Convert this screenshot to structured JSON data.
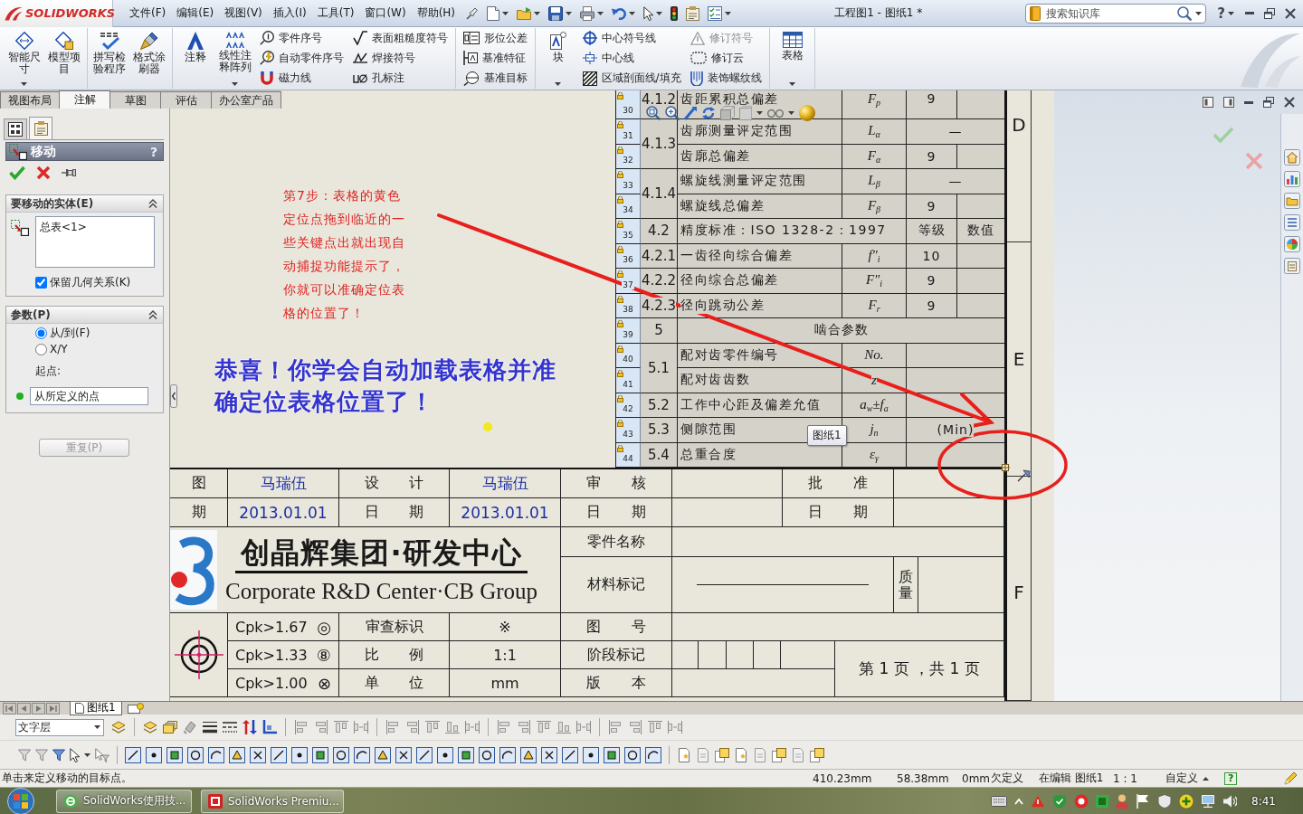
{
  "window": {
    "logo": "SOLIDWORKS",
    "menu": [
      "文件(F)",
      "编辑(E)",
      "视图(V)",
      "插入(I)",
      "工具(T)",
      "窗口(W)",
      "帮助(H)"
    ],
    "title": "工程图1 - 图纸1 *",
    "search": {
      "placeholder": "搜索知识库"
    },
    "help": "?"
  },
  "ribbon": {
    "groups": [
      {
        "items": [
          {
            "kind": "large",
            "label": "智能尺寸",
            "dropdown": true,
            "disabled": false
          },
          {
            "kind": "large",
            "label": "模型项目",
            "dropdown": false,
            "disabled": false
          }
        ]
      },
      {
        "items": [
          {
            "kind": "large",
            "label": "拼写检验程序",
            "dropdown": false,
            "disabled": false
          },
          {
            "kind": "large",
            "label": "格式涂刷器",
            "dropdown": false,
            "disabled": false
          }
        ]
      },
      {
        "items": [
          {
            "kind": "large",
            "label": "注释",
            "dropdown": false,
            "disabled": false
          },
          {
            "kind": "large",
            "label": "线性注释阵列",
            "dropdown": true,
            "disabled": false
          },
          {
            "kind": "small",
            "label": "零件序号",
            "dropdown": false,
            "disabled": false
          },
          {
            "kind": "small",
            "label": "自动零件序号",
            "dropdown": false,
            "disabled": false
          },
          {
            "kind": "small",
            "label": "磁力线",
            "dropdown": false,
            "disabled": false
          },
          {
            "kind": "small",
            "label": "表面粗糙度符号",
            "dropdown": false,
            "disabled": false
          },
          {
            "kind": "small",
            "label": "焊接符号",
            "dropdown": false,
            "disabled": false
          },
          {
            "kind": "small",
            "label": "孔标注",
            "dropdown": false,
            "disabled": false
          }
        ]
      },
      {
        "items": [
          {
            "kind": "small",
            "label": "形位公差",
            "dropdown": false,
            "disabled": false
          },
          {
            "kind": "small",
            "label": "基准特征",
            "dropdown": false,
            "disabled": false
          },
          {
            "kind": "small",
            "label": "基准目标",
            "dropdown": false,
            "disabled": false
          }
        ]
      },
      {
        "items": [
          {
            "kind": "large",
            "label": "块",
            "dropdown": true,
            "disabled": false
          },
          {
            "kind": "small",
            "label": "中心符号线",
            "dropdown": false,
            "disabled": false
          },
          {
            "kind": "small",
            "label": "中心线",
            "dropdown": false,
            "disabled": false
          },
          {
            "kind": "small",
            "label": "区域剖面线/填充",
            "dropdown": false,
            "disabled": false
          },
          {
            "kind": "small",
            "label": "修订符号",
            "dropdown": false,
            "disabled": true
          },
          {
            "kind": "small",
            "label": "修订云",
            "dropdown": false,
            "disabled": false
          },
          {
            "kind": "small",
            "label": "装饰螺纹线",
            "dropdown": false,
            "disabled": false
          }
        ]
      },
      {
        "items": [
          {
            "kind": "large",
            "label": "表格",
            "dropdown": true,
            "disabled": false
          }
        ]
      }
    ],
    "tabs": [
      {
        "label": "视图布局",
        "selected": false
      },
      {
        "label": "注解",
        "selected": true
      },
      {
        "label": "草图",
        "selected": false
      },
      {
        "label": "评估",
        "selected": false
      },
      {
        "label": "办公室产品",
        "selected": false
      }
    ]
  },
  "property_manager": {
    "tabs": [
      {
        "selected": false
      },
      {
        "selected": true
      }
    ],
    "title": "移动",
    "help": "?",
    "entities": {
      "title": "要移动的实体(E)",
      "expanded": true,
      "items": [
        "总表<1>"
      ],
      "checkbox": {
        "label": "保留几何关系(K)",
        "checked": true
      }
    },
    "parameters": {
      "title": "参数(P)",
      "expanded": true,
      "options": [
        {
          "label": "从/到(F)",
          "selected": true
        },
        {
          "label": "X/Y",
          "selected": false
        }
      ],
      "start_label": "起点:",
      "start_point": {
        "value": "从所定义的点"
      }
    },
    "repeat_button": {
      "label": "重复(P)",
      "disabled": true
    }
  },
  "drawing": {
    "note": "第7步：表格的黄色定位点拖到临近的一些关键点出就出现自动捕捉功能提示了，你就可以准确定位表格的位置了！",
    "headline": "恭喜！你学会自动加载表格并准确定位表格位置了！",
    "table": {
      "rows": [
        {
          "number": "30",
          "cells": [
            {
              "kind": "index",
              "text": "4.1.2"
            },
            {
              "kind": "text",
              "text": "齿距累积总偏差"
            },
            {
              "kind": "symbol",
              "text": "F$_{p}$"
            },
            {
              "kind": "value",
              "text": "9"
            },
            {
              "kind": "blank"
            }
          ]
        },
        {
          "number": "31",
          "cells": [
            {
              "kind": "index",
              "text": "4.1.3",
              "rowspan": 2
            },
            {
              "kind": "text",
              "text": "齿廓测量评定范围"
            },
            {
              "kind": "symbol",
              "text": "L$_{α}$"
            },
            {
              "kind": "value",
              "text": "—",
              "colspan": 2
            }
          ]
        },
        {
          "number": "32",
          "cells": [
            {
              "kind": "text",
              "text": "齿廓总偏差"
            },
            {
              "kind": "symbol",
              "text": "F$_{α}$"
            },
            {
              "kind": "value",
              "text": "9"
            },
            {
              "kind": "blank"
            }
          ]
        },
        {
          "number": "33",
          "cells": [
            {
              "kind": "index",
              "text": "4.1.4",
              "rowspan": 2
            },
            {
              "kind": "text",
              "text": "螺旋线测量评定范围"
            },
            {
              "kind": "symbol",
              "text": "L$_{β}$"
            },
            {
              "kind": "value",
              "text": "—",
              "colspan": 2
            }
          ]
        },
        {
          "number": "34",
          "cells": [
            {
              "kind": "text",
              "text": "螺旋线总偏差"
            },
            {
              "kind": "symbol",
              "text": "F$_{β}$"
            },
            {
              "kind": "value",
              "text": "9"
            },
            {
              "kind": "blank"
            }
          ]
        },
        {
          "number": "35",
          "cells": [
            {
              "kind": "index",
              "text": "4.2"
            },
            {
              "kind": "text",
              "text": "精度标准：ISO 1328-2：1997",
              "colspan": 2
            },
            {
              "kind": "value",
              "text": "等级"
            },
            {
              "kind": "value",
              "text": "数值"
            }
          ]
        },
        {
          "number": "36",
          "cells": [
            {
              "kind": "index",
              "text": "4.2.1"
            },
            {
              "kind": "text",
              "text": "一齿径向综合偏差"
            },
            {
              "kind": "symbol",
              "text": "f″$_{i}$"
            },
            {
              "kind": "value",
              "text": "10"
            },
            {
              "kind": "blank"
            }
          ]
        },
        {
          "number": "37",
          "cells": [
            {
              "kind": "index",
              "text": "4.2.2"
            },
            {
              "kind": "text",
              "text": "径向综合总偏差"
            },
            {
              "kind": "symbol",
              "text": "F″$_{i}$"
            },
            {
              "kind": "value",
              "text": "9"
            },
            {
              "kind": "blank"
            }
          ]
        },
        {
          "number": "38",
          "cells": [
            {
              "kind": "index",
              "text": "4.2.3"
            },
            {
              "kind": "text",
              "text": "径向跳动公差"
            },
            {
              "kind": "symbol",
              "text": "F$_{r}$"
            },
            {
              "kind": "value",
              "text": "9"
            },
            {
              "kind": "blank"
            }
          ]
        },
        {
          "number": "39",
          "cells": [
            {
              "kind": "index",
              "text": "5"
            },
            {
              "kind": "value",
              "text": "啮合参数",
              "colspan": 4
            }
          ]
        },
        {
          "number": "40",
          "cells": [
            {
              "kind": "index",
              "text": "5.1",
              "rowspan": 2
            },
            {
              "kind": "text",
              "text": "配对齿零件编号"
            },
            {
              "kind": "symbol",
              "text": "No."
            },
            {
              "kind": "blank",
              "colspan": 2
            }
          ]
        },
        {
          "number": "41",
          "cells": [
            {
              "kind": "text",
              "text": "配对齿齿数"
            },
            {
              "kind": "symbol",
              "text": "z"
            },
            {
              "kind": "blank",
              "colspan": 2
            }
          ]
        },
        {
          "number": "42",
          "cells": [
            {
              "kind": "index",
              "text": "5.2"
            },
            {
              "kind": "text",
              "text": "工作中心距及偏差允值"
            },
            {
              "kind": "symbol",
              "text": "a$_{w}$±f$_{a}$"
            },
            {
              "kind": "blank",
              "colspan": 2
            }
          ]
        },
        {
          "number": "43",
          "cells": [
            {
              "kind": "index",
              "text": "5.3"
            },
            {
              "kind": "text",
              "text": "侧隙范围"
            },
            {
              "kind": "symbol",
              "text": "j$_{n}$"
            },
            {
              "kind": "value",
              "text": "(Min)",
              "colspan": 2
            }
          ]
        },
        {
          "number": "44",
          "cells": [
            {
              "kind": "index",
              "text": "5.4"
            },
            {
              "kind": "text",
              "text": "总重合度"
            },
            {
              "kind": "symbol",
              "text": "ε$_{γ}$"
            },
            {
              "kind": "blank",
              "colspan": 2
            }
          ]
        }
      ]
    },
    "tooltip": "图纸1",
    "title_block": {
      "sign_rows": [
        [
          {
            "kind": "label",
            "text": "图"
          },
          {
            "kind": "entry",
            "text": "马瑞伍"
          },
          {
            "kind": "label",
            "text": "设 计"
          },
          {
            "kind": "entry",
            "text": "马瑞伍"
          },
          {
            "kind": "label",
            "text": "审 核"
          },
          {
            "kind": "blank"
          },
          {
            "kind": "label",
            "text": "批 准"
          },
          {
            "kind": "blank"
          }
        ],
        [
          {
            "kind": "label",
            "text": "期"
          },
          {
            "kind": "entry",
            "text": "2013.01.01"
          },
          {
            "kind": "label",
            "text": "日 期"
          },
          {
            "kind": "entry",
            "text": "2013.01.01"
          },
          {
            "kind": "label",
            "text": "日 期"
          },
          {
            "kind": "blank"
          },
          {
            "kind": "label",
            "text": "日 期"
          },
          {
            "kind": "blank"
          }
        ]
      ],
      "company": {
        "name": "创晶辉集团·研发中心",
        "english": "Corporate R&D Center·CB Group"
      },
      "part_name_label": "零件名称",
      "material_label": "材料标记",
      "mass_label": "质量",
      "quality_rows": [
        {
          "grade": "Cpk>1.67",
          "symbol": "◎",
          "cells": [
            {
              "kind": "label",
              "text": "审查标识"
            },
            {
              "kind": "value",
              "text": "※"
            },
            {
              "kind": "label",
              "text": "图 号"
            }
          ]
        },
        {
          "grade": "Cpk>1.33",
          "symbol": "⑧",
          "cells": [
            {
              "kind": "label",
              "text": "比 例"
            },
            {
              "kind": "value",
              "text": "1:1"
            },
            {
              "kind": "label",
              "text": "阶段标记"
            }
          ]
        },
        {
          "grade": "Cpk>1.00",
          "symbol": "⊗",
          "cells": [
            {
              "kind": "label",
              "text": "单 位"
            },
            {
              "kind": "value",
              "text": "mm"
            },
            {
              "kind": "label",
              "text": "版 本"
            }
          ]
        }
      ],
      "page": "第 1 页 ，共 1 页"
    },
    "zones": [
      "D",
      "E",
      "F"
    ]
  },
  "sheet_tabs": [
    {
      "label": "图纸1",
      "selected": true
    }
  ],
  "layer": {
    "value": "文字层"
  },
  "status_bar": {
    "message": "单击来定义移动的目标点。",
    "fields": [
      "410.23mm",
      "58.38mm",
      "0mm",
      "欠定义",
      "在编辑 图纸1",
      "1 : 1",
      "自定义"
    ],
    "help": "?"
  },
  "taskbar": {
    "buttons": [
      "SolidWorks使用技...",
      "SolidWorks Premiu..."
    ],
    "clock": "8:41"
  }
}
